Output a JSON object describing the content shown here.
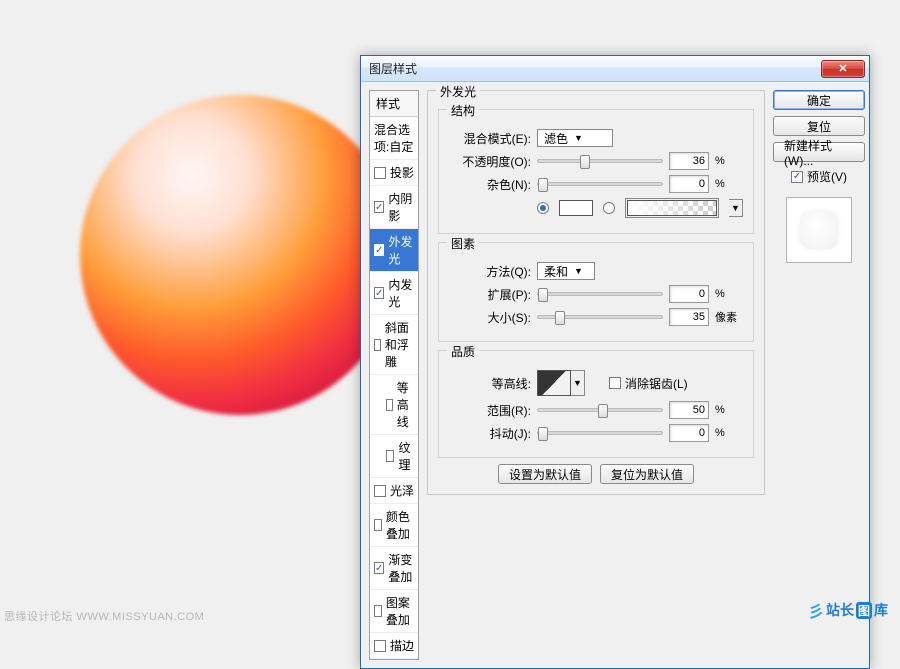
{
  "dialog": {
    "title": "图层样式",
    "styles_header": "样式",
    "styles": [
      {
        "label": "混合选项:自定",
        "checked": null,
        "sel": false,
        "indent": false
      },
      {
        "label": "投影",
        "checked": false,
        "sel": false,
        "indent": false
      },
      {
        "label": "内阴影",
        "checked": true,
        "sel": false,
        "indent": false
      },
      {
        "label": "外发光",
        "checked": true,
        "sel": true,
        "indent": false
      },
      {
        "label": "内发光",
        "checked": true,
        "sel": false,
        "indent": false
      },
      {
        "label": "斜面和浮雕",
        "checked": false,
        "sel": false,
        "indent": false
      },
      {
        "label": "等高线",
        "checked": false,
        "sel": false,
        "indent": true
      },
      {
        "label": "纹理",
        "checked": false,
        "sel": false,
        "indent": true
      },
      {
        "label": "光泽",
        "checked": false,
        "sel": false,
        "indent": false
      },
      {
        "label": "颜色叠加",
        "checked": false,
        "sel": false,
        "indent": false
      },
      {
        "label": "渐变叠加",
        "checked": true,
        "sel": false,
        "indent": false
      },
      {
        "label": "图案叠加",
        "checked": false,
        "sel": false,
        "indent": false
      },
      {
        "label": "描边",
        "checked": false,
        "sel": false,
        "indent": false
      }
    ],
    "panel_title": "外发光",
    "structure": {
      "title": "结构",
      "blend_label": "混合模式(E):",
      "blend_value": "滤色",
      "opacity_label": "不透明度(O):",
      "opacity_value": "36",
      "opacity_unit": "%",
      "noise_label": "杂色(N):",
      "noise_value": "0",
      "noise_unit": "%"
    },
    "elements": {
      "title": "图素",
      "technique_label": "方法(Q):",
      "technique_value": "柔和",
      "spread_label": "扩展(P):",
      "spread_value": "0",
      "spread_unit": "%",
      "size_label": "大小(S):",
      "size_value": "35",
      "size_unit": "像素"
    },
    "quality": {
      "title": "品质",
      "contour_label": "等高线:",
      "antialias_label": "消除锯齿(L)",
      "range_label": "范围(R):",
      "range_value": "50",
      "range_unit": "%",
      "jitter_label": "抖动(J):",
      "jitter_value": "0",
      "jitter_unit": "%"
    },
    "defaults": {
      "set": "设置为默认值",
      "reset": "复位为默认值"
    },
    "buttons": {
      "ok": "确定",
      "cancel": "复位",
      "new_style": "新建样式(W)...",
      "preview": "预览(V)"
    }
  },
  "footer": {
    "left": "思缘设计论坛  WWW.MISSYUAN.COM",
    "right_brand": "站长",
    "right_suffix": "库"
  }
}
